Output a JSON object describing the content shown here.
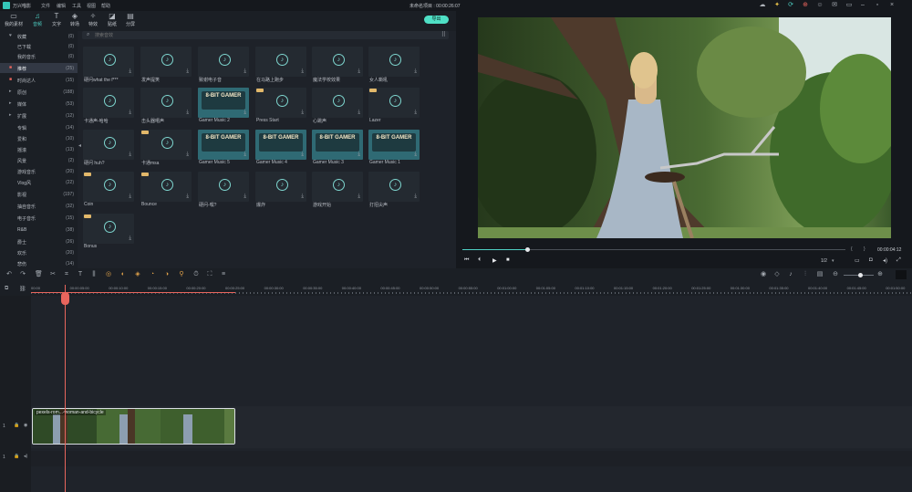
{
  "window": {
    "app_name": "万兴喵影",
    "menu": [
      "文件",
      "编辑",
      "工具",
      "视图",
      "帮助"
    ],
    "project_title": "未命名项目 : 00:00:26:07"
  },
  "toolbar": {
    "tabs": [
      {
        "label": "我的素材",
        "icon": "folder-icon"
      },
      {
        "label": "音频",
        "icon": "music-note-icon"
      },
      {
        "label": "文字",
        "icon": "text-icon"
      },
      {
        "label": "转场",
        "icon": "transition-icon"
      },
      {
        "label": "特效",
        "icon": "effects-icon"
      },
      {
        "label": "贴纸",
        "icon": "sticker-icon"
      },
      {
        "label": "分屏",
        "icon": "split-screen-icon"
      }
    ],
    "active_tab": "音频",
    "export_label": "导出"
  },
  "sidebar": {
    "items": [
      {
        "label": "收藏",
        "count": "(0)",
        "icon": "heart-icon"
      },
      {
        "label": "已下载",
        "count": "(0)"
      },
      {
        "label": "我的音乐",
        "count": "(0)"
      },
      {
        "label": "推荐",
        "count": "(25)",
        "active": true
      },
      {
        "label": "时尚达人",
        "count": "(15)"
      },
      {
        "label": "原创",
        "count": "(188)",
        "expandable": true
      },
      {
        "label": "媒体",
        "count": "(53)",
        "expandable": true
      },
      {
        "label": "扩展",
        "count": "(12)",
        "expandable": true
      },
      {
        "label": "专辑",
        "count": "(14)"
      },
      {
        "label": "爱和",
        "count": "(10)"
      },
      {
        "label": "摇滚",
        "count": "(13)"
      },
      {
        "label": "风景",
        "count": "(2)"
      },
      {
        "label": "游戏音乐",
        "count": "(20)"
      },
      {
        "label": "Vlog风",
        "count": "(22)"
      },
      {
        "label": "影视",
        "count": "(197)"
      },
      {
        "label": "抽自音乐",
        "count": "(32)"
      },
      {
        "label": "电子音乐",
        "count": "(15)"
      },
      {
        "label": "R&B",
        "count": "(38)"
      },
      {
        "label": "爵士",
        "count": "(26)"
      },
      {
        "label": "欢乐",
        "count": "(20)"
      },
      {
        "label": "悲伤",
        "count": "(14)"
      }
    ]
  },
  "search": {
    "placeholder": "搜索音效"
  },
  "audio_items": [
    {
      "title": "硬问what the f***",
      "kind": "note"
    },
    {
      "title": "发声提笑",
      "kind": "note"
    },
    {
      "title": "致谢电子音",
      "kind": "note"
    },
    {
      "title": "在马路上跑步",
      "kind": "note"
    },
    {
      "title": "魔法学校效果",
      "kind": "note"
    },
    {
      "title": "女人嘶吼",
      "kind": "note"
    },
    {
      "title": "卡通声-哈哈",
      "kind": "note"
    },
    {
      "title": "击头器噶声",
      "kind": "note"
    },
    {
      "title": "Gamer Music 2",
      "kind": "game"
    },
    {
      "title": "Press Start",
      "kind": "note",
      "vip": true
    },
    {
      "title": "心跳声",
      "kind": "note"
    },
    {
      "title": "Lazer",
      "kind": "note",
      "vip": true
    },
    {
      "title": "硬问 huh?",
      "kind": "note"
    },
    {
      "title": "卡通msa",
      "kind": "note",
      "vip": true
    },
    {
      "title": "Gamer Music 5",
      "kind": "game"
    },
    {
      "title": "Gamer Music 4",
      "kind": "game"
    },
    {
      "title": "Gamer Music 3",
      "kind": "game"
    },
    {
      "title": "Gamer Music 1",
      "kind": "game"
    },
    {
      "title": "Coin",
      "kind": "note",
      "vip": true
    },
    {
      "title": "Bounce",
      "kind": "note",
      "vip": true
    },
    {
      "title": "硬问-嘿?",
      "kind": "note"
    },
    {
      "title": "爆炸",
      "kind": "note"
    },
    {
      "title": "游戏开始",
      "kind": "note"
    },
    {
      "title": "打招尖声",
      "kind": "note"
    },
    {
      "title": "Bonus",
      "kind": "note",
      "vip": true
    }
  ],
  "game_card_text": "8-BIT GAMER",
  "player": {
    "timecode": "00:00:04:12",
    "zoom": "1/2",
    "bracket_in": "{",
    "bracket_out": "}",
    "progress_fraction": 0.17
  },
  "timeline": {
    "ruler": [
      "00:00",
      "00:00:05:00",
      "00:00:10:00",
      "00:00:15:00",
      "00:00:20:00",
      "00:00:25:00",
      "00:00:30:00",
      "00:00:35:00",
      "00:00:40:00",
      "00:00:45:00",
      "00:00:50:00",
      "00:00:55:00",
      "00:01:00:00",
      "00:01:05:00",
      "00:01:10:00",
      "00:01:15:00",
      "00:01:20:00",
      "00:01:25:00",
      "00:01:30:00",
      "00:01:35:00",
      "00:01:40:00",
      "00:01:45:00",
      "00:01:50:00"
    ],
    "clip_name": "pexels-rom...-woman-and-bicycle",
    "video_track_label": "1",
    "audio_track_label": "1"
  },
  "colors": {
    "accent": "#4fd1c5",
    "playhead": "#e8655d",
    "export": "#4fe0c6"
  }
}
